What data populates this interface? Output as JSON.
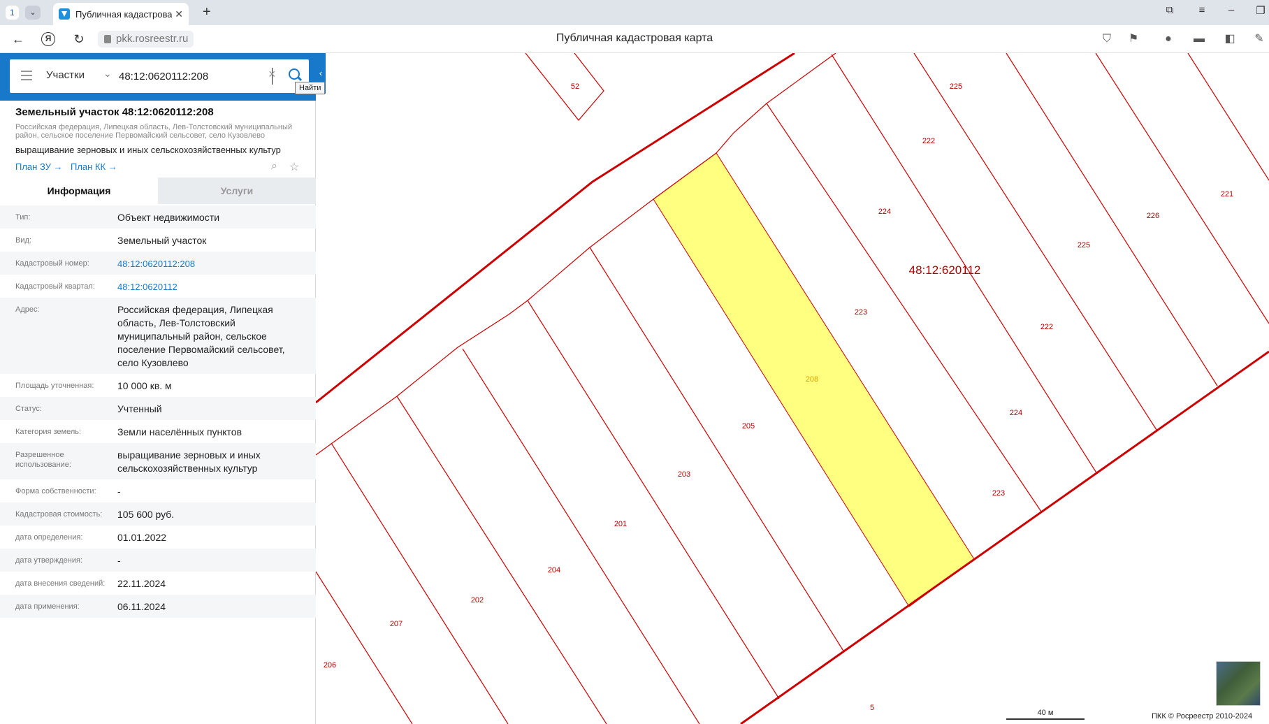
{
  "browser": {
    "tab_count": "1",
    "tab_title": "Публичная кадастровая",
    "url": "pkk.rosreestr.ru",
    "page_title": "Публичная кадастровая карта"
  },
  "search": {
    "type": "Участки",
    "query": "48:12:0620112:208",
    "tooltip": "Найти"
  },
  "object": {
    "title": "Земельный участок 48:12:0620112:208",
    "address_short": "Российская федерация, Липецкая область, Лев-Толстовский муниципальный район, сельское поселение Первомайский сельсовет, село Кузовлево",
    "use": "выращивание зерновых и иных сельскохозяйственных культур",
    "plan_zu": "План ЗУ →",
    "plan_kk": "План КК →"
  },
  "tabs": {
    "info": "Информация",
    "services": "Услуги"
  },
  "rows": [
    {
      "label": "Тип:",
      "value": "Объект недвижимости"
    },
    {
      "label": "Вид:",
      "value": "Земельный участок"
    },
    {
      "label": "Кадастровый номер:",
      "value": "48:12:0620112:208"
    },
    {
      "label": "Кадастровый квартал:",
      "value": "48:12:0620112"
    },
    {
      "label": "Адрес:",
      "value": "Российская федерация, Липецкая область, Лев-Толстовский муниципальный район, сельское поселение Первомайский сельсовет, село Кузовлево"
    },
    {
      "label": "Площадь уточненная:",
      "value": "10 000 кв. м"
    },
    {
      "label": "Статус:",
      "value": "Учтенный"
    },
    {
      "label": "Категория земель:",
      "value": "Земли населённых пунктов"
    },
    {
      "label": "Разрешенное использование:",
      "value": "выращивание зерновых и иных сельскохозяйственных культур"
    },
    {
      "label": "Форма собственности:",
      "value": "-"
    },
    {
      "label": "Кадастровая стоимость:",
      "value": "105 600 руб."
    },
    {
      "label": "дата определения:",
      "value": "01.01.2022"
    },
    {
      "label": "дата утверждения:",
      "value": "-"
    },
    {
      "label": "дата внесения сведений:",
      "value": "22.11.2024"
    },
    {
      "label": "дата применения:",
      "value": "06.11.2024"
    }
  ],
  "map": {
    "quarter_label": "48:12:620112",
    "parcel_labels": [
      "52",
      "225",
      "222",
      "224",
      "221",
      "226",
      "225",
      "223",
      "222",
      "208",
      "205",
      "224",
      "203",
      "223",
      "201",
      "204",
      "202",
      "207",
      "206",
      "5"
    ],
    "scale": "40 м",
    "copyright": "ПКК © Росреестр 2010-2024",
    "line_color": "#cc0000",
    "highlight_color": "#ffff80"
  }
}
